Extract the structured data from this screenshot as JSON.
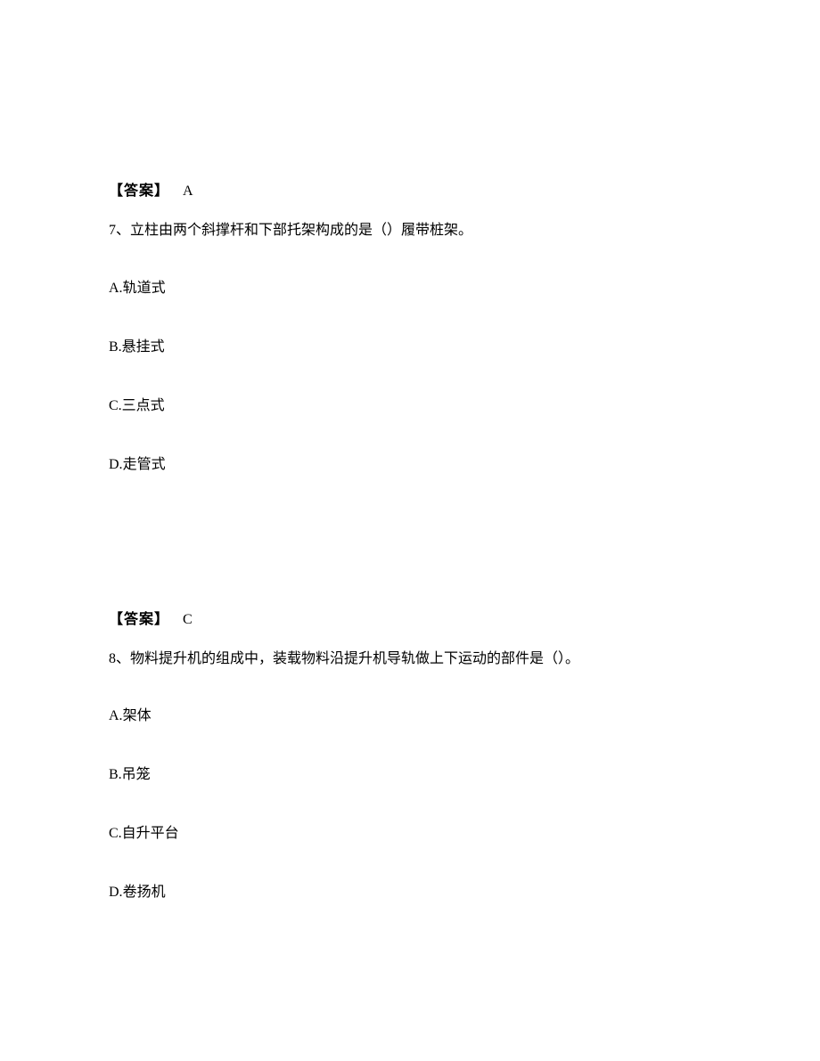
{
  "block1": {
    "answer_label": "【答案】",
    "answer_value": "A"
  },
  "question7": {
    "number": "7",
    "separator": "、",
    "stem": "立柱由两个斜撑杆和下部托架构成的是（）履带桩架。",
    "options": {
      "A": {
        "letter": "A.",
        "text": "轨道式"
      },
      "B": {
        "letter": "B.",
        "text": "悬挂式"
      },
      "C": {
        "letter": "C.",
        "text": "三点式"
      },
      "D": {
        "letter": "D.",
        "text": "走管式"
      }
    }
  },
  "block2": {
    "answer_label": "【答案】",
    "answer_value": "C"
  },
  "question8": {
    "number": "8",
    "separator": "、",
    "stem": "物料提升机的组成中，装载物料沿提升机导轨做上下运动的部件是（）。",
    "options": {
      "A": {
        "letter": "A.",
        "text": "架体"
      },
      "B": {
        "letter": "B.",
        "text": "吊笼"
      },
      "C": {
        "letter": "C.",
        "text": "自升平台"
      },
      "D": {
        "letter": "D.",
        "text": "卷扬机"
      }
    }
  }
}
